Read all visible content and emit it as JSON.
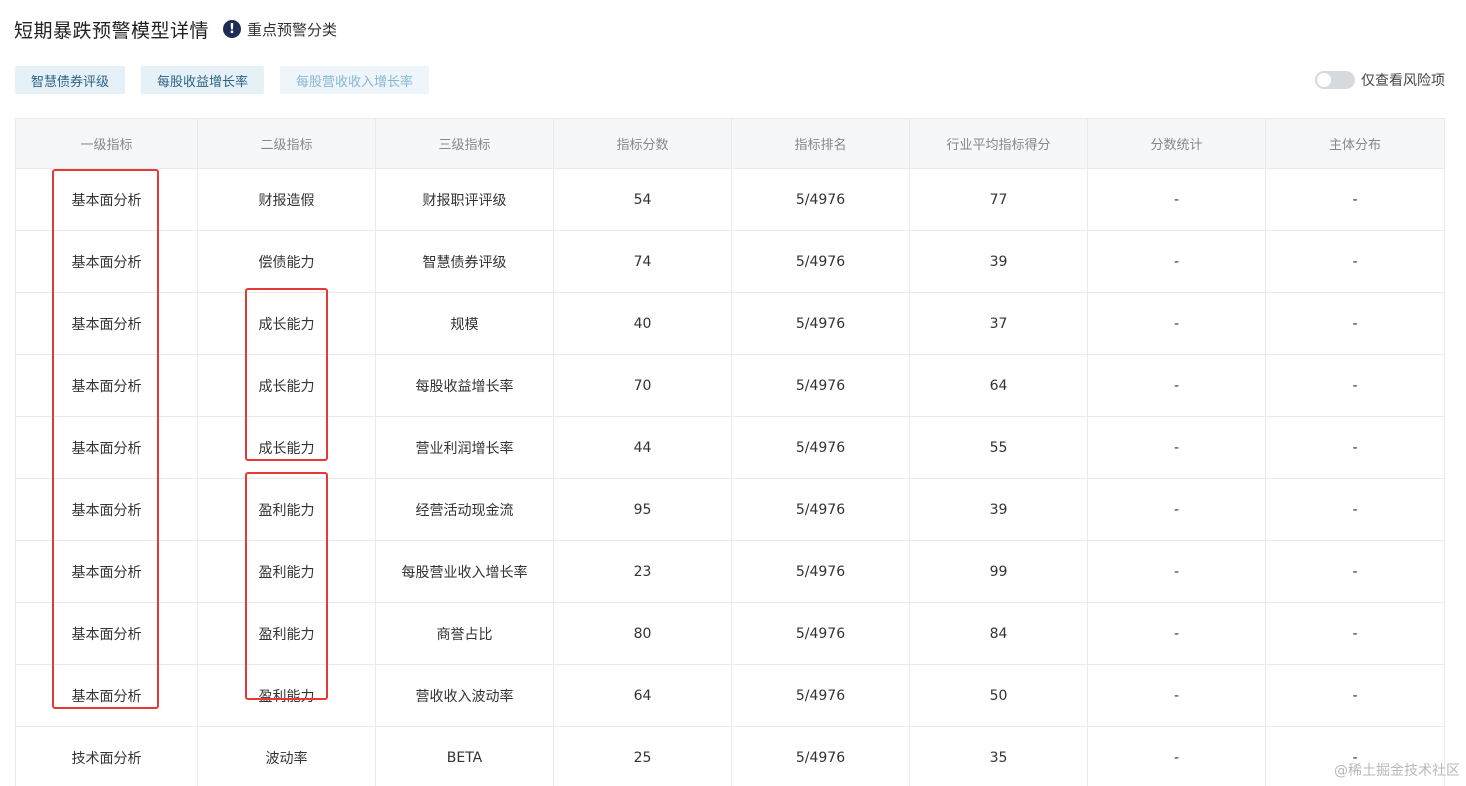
{
  "header": {
    "title": "短期暴跌预警模型详情",
    "warn_icon": "!",
    "subtitle": "重点预警分类"
  },
  "tabs": [
    {
      "label": "智慧债券评级",
      "state": "active"
    },
    {
      "label": "每股收益增长率",
      "state": "active"
    },
    {
      "label": "每股营收收入增长率",
      "state": "inactive"
    }
  ],
  "toggle": {
    "label": "仅查看风险项",
    "on": false
  },
  "table": {
    "columns": [
      "一级指标",
      "二级指标",
      "三级指标",
      "指标分数",
      "指标排名",
      "行业平均指标得分",
      "分数统计",
      "主体分布"
    ],
    "rows": [
      [
        "基本面分析",
        "财报造假",
        "财报职评评级",
        "54",
        "5/4976",
        "77",
        "-",
        "-"
      ],
      [
        "基本面分析",
        "偿债能力",
        "智慧债券评级",
        "74",
        "5/4976",
        "39",
        "-",
        "-"
      ],
      [
        "基本面分析",
        "成长能力",
        "规模",
        "40",
        "5/4976",
        "37",
        "-",
        "-"
      ],
      [
        "基本面分析",
        "成长能力",
        "每股收益增长率",
        "70",
        "5/4976",
        "64",
        "-",
        "-"
      ],
      [
        "基本面分析",
        "成长能力",
        "营业利润增长率",
        "44",
        "5/4976",
        "55",
        "-",
        "-"
      ],
      [
        "基本面分析",
        "盈利能力",
        "经营活动现金流",
        "95",
        "5/4976",
        "39",
        "-",
        "-"
      ],
      [
        "基本面分析",
        "盈利能力",
        "每股营业收入增长率",
        "23",
        "5/4976",
        "99",
        "-",
        "-"
      ],
      [
        "基本面分析",
        "盈利能力",
        "商誉占比",
        "80",
        "5/4976",
        "84",
        "-",
        "-"
      ],
      [
        "基本面分析",
        "盈利能力",
        "营收收入波动率",
        "64",
        "5/4976",
        "50",
        "-",
        "-"
      ],
      [
        "技术面分析",
        "波动率",
        "BETA",
        "25",
        "5/4976",
        "35",
        "-",
        "-"
      ]
    ]
  },
  "watermark": "@稀土掘金技术社区",
  "colors": {
    "highlight": "#e53935",
    "tab_active_bg": "#e6f1f7",
    "tab_active_text": "#2d6286",
    "tab_inactive_text": "#87b7d2",
    "header_bg": "#f5f7f9"
  }
}
